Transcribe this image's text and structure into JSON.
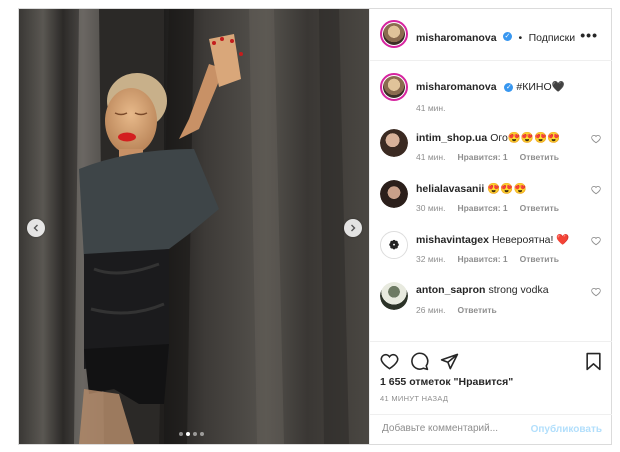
{
  "post": {
    "author": {
      "username": "misharomanova",
      "verified_icon": "verified-badge-icon",
      "separator": "•",
      "follow_label": "Подписки"
    },
    "caption": {
      "username": "misharomanova",
      "text": "#КИНО🖤",
      "time": "41 мин."
    },
    "carousel": {
      "total_slides": 4,
      "active_slide": 2
    },
    "comments": [
      {
        "username": "intim_shop.ua",
        "text": "Ого😍😍😍😍",
        "time": "41 мин.",
        "likes": "Нравится: 1",
        "reply": "Ответить"
      },
      {
        "username": "helialavasanii",
        "text": "😍😍😍",
        "time": "30 мин.",
        "likes": "Нравится: 1",
        "reply": "Ответить"
      },
      {
        "username": "mishavintagex",
        "text": "Невероятна! ❤️",
        "time": "32 мин.",
        "likes": "Нравится: 1",
        "reply": "Ответить"
      },
      {
        "username": "anton_sapron",
        "text": "strong vodka",
        "time": "26 мин.",
        "likes": "",
        "reply": "Ответить"
      }
    ],
    "likes_text": "1 655 отметок \"Нравится\"",
    "time_ago": "41 МИНУТ НАЗАД",
    "add_comment": {
      "placeholder": "Добавьте комментарий...",
      "publish_label": "Опубликовать"
    },
    "colors": {
      "accent": "#3897f0",
      "publish_disabled": "#b2dffc",
      "muted": "#8e8e8e",
      "text": "#262626",
      "heart_red": "#ed4956"
    }
  }
}
